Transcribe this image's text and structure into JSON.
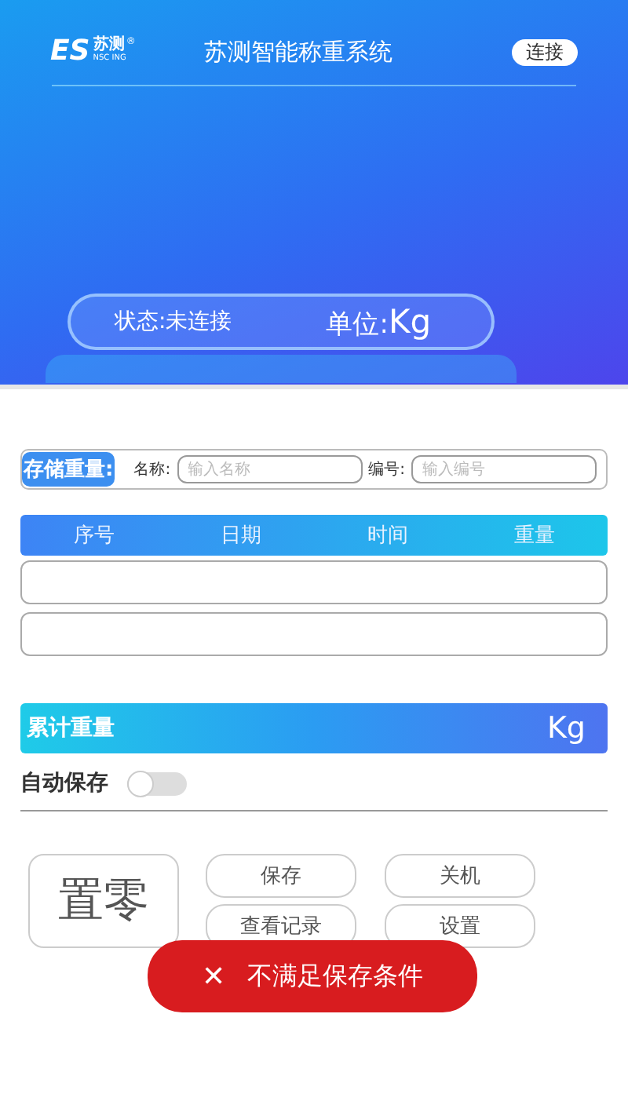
{
  "header": {
    "logo": {
      "mark": "ES",
      "name": "苏测",
      "sub": "NSC ING",
      "registered": "®"
    },
    "title": "苏测智能称重系统",
    "connect_button": "连接"
  },
  "status": {
    "state": "状态:未连接",
    "unit_label": "单位:",
    "unit": "Kg"
  },
  "storage": {
    "label": "存储重量:",
    "name_label": "名称:",
    "name_placeholder": "输入名称",
    "code_label": "编号:",
    "code_placeholder": "输入编号"
  },
  "table": {
    "columns": [
      "序号",
      "日期",
      "时间",
      "重量"
    ]
  },
  "total": {
    "label": "累计重量",
    "unit": "Kg"
  },
  "auto_save": {
    "label": "自动保存",
    "on": false
  },
  "zero_button": "置零",
  "buttons": [
    "保存",
    "关机",
    "查看记录",
    "设置"
  ],
  "toast": {
    "icon": "✕",
    "message": "不满足保存条件"
  }
}
